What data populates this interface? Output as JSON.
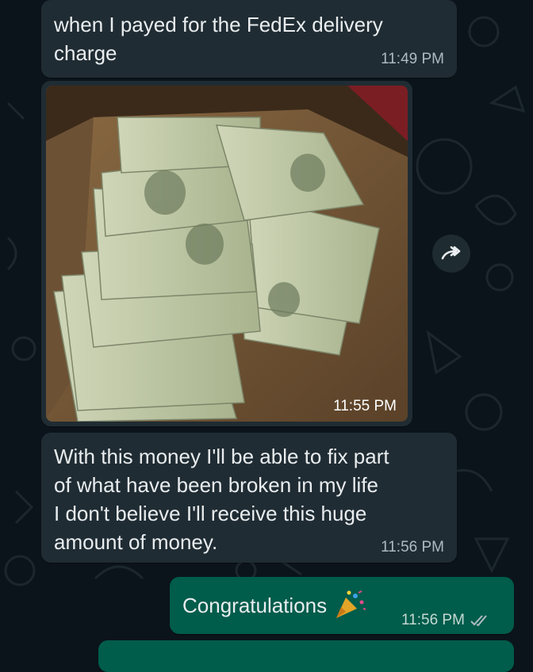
{
  "messages": [
    {
      "text": "when I payed for the FedEx delivery\ncharge",
      "time": "11:49 PM"
    },
    {
      "image": "photo-cash-in-box",
      "time": "11:55 PM"
    },
    {
      "text": "With this money I'll be able to fix part\nof what have been broken in my life\nI don't believe I'll receive this huge\namount of money.",
      "time": "11:56 PM"
    },
    {
      "text": "Congratulations",
      "emoji": "party-popper-icon",
      "time": "11:56 PM",
      "status": "read"
    }
  ],
  "icons": {
    "forward": "forward-icon",
    "read_ticks": "double-check-icon"
  },
  "colors": {
    "background": "#0b141a",
    "incoming": "#202c33",
    "outgoing": "#005c4b",
    "read_ticks": "#aebac1"
  }
}
